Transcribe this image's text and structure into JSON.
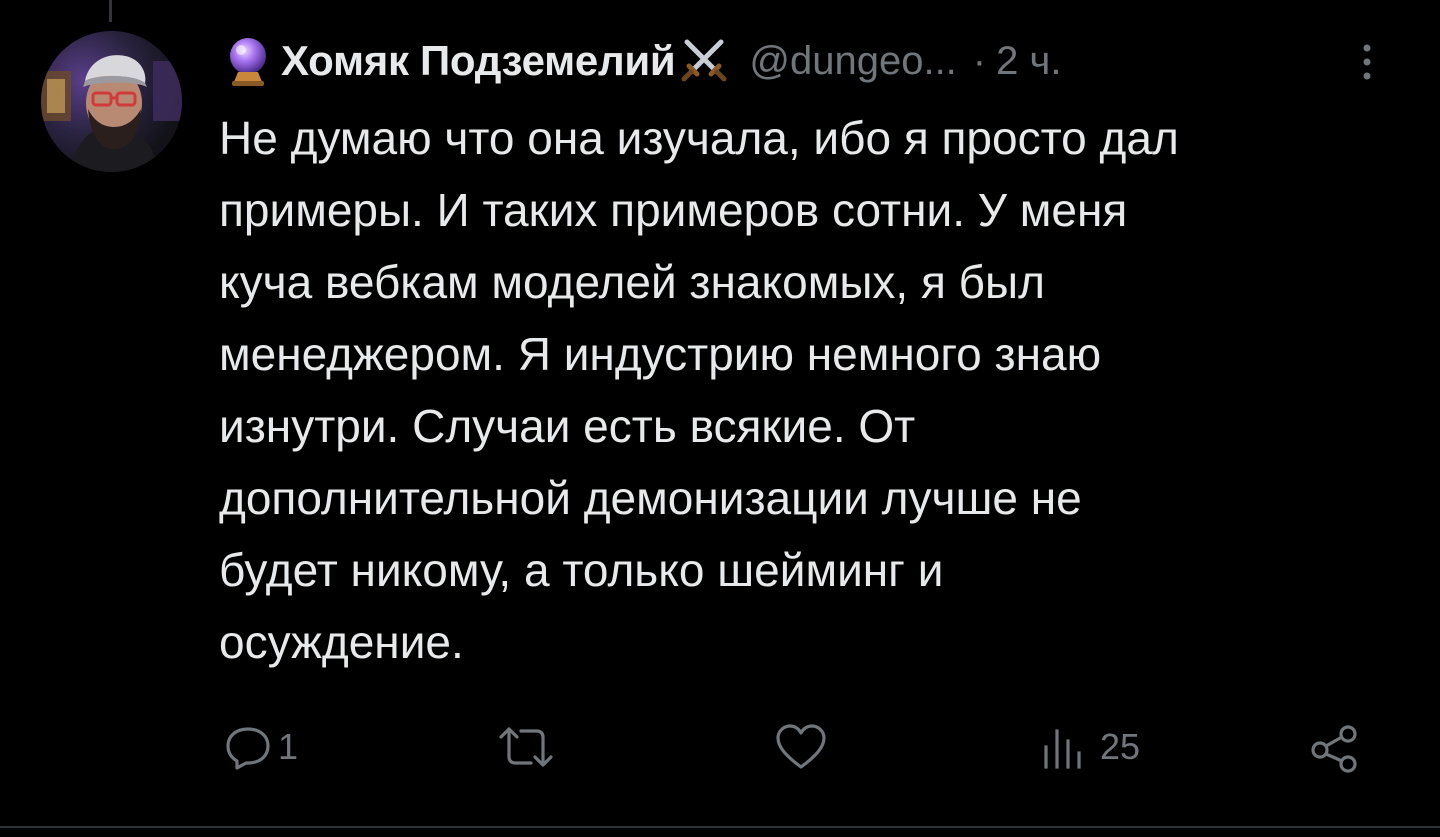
{
  "author": {
    "display_name": "Хомяк Подземелий",
    "handle": "@dungeo...",
    "separator": "·",
    "time": "2 ч.",
    "name_emoji_left": "crystal-ball-emoji",
    "name_emoji_right": "crossed-swords-emoji"
  },
  "tweet": {
    "lines": [
      "Не думаю что она изучала, ибо я просто дал",
      "примеры. И таких примеров сотни. У меня",
      "куча вебкам моделей знакомых, я был",
      "менеджером. Я индустрию немного знаю",
      "изнутри. Случаи есть всякие. От",
      "дополнительной демонизации лучше не",
      "будет никому, а только шейминг и",
      "осуждение."
    ]
  },
  "actions": {
    "reply_count": "1",
    "retweet_count": "",
    "like_count": "",
    "views_count": "25"
  },
  "icons": {
    "reply": "reply-icon",
    "retweet": "retweet-icon",
    "like": "heart-icon",
    "views": "views-icon",
    "share": "share-icon",
    "more": "more-icon"
  },
  "colors": {
    "background": "#000000",
    "text": "#e7e9ea",
    "muted": "#71767b",
    "border": "#2f3336"
  }
}
